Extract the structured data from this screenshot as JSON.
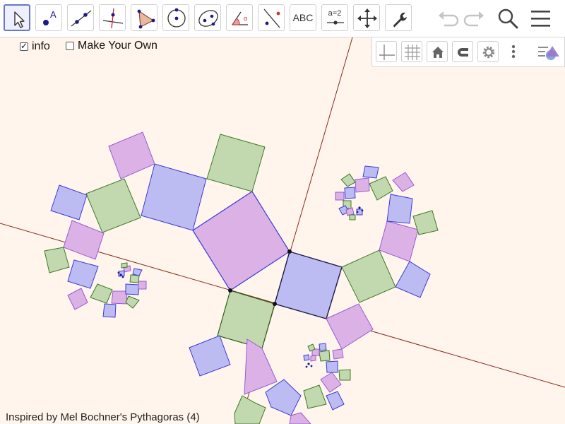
{
  "toolbar": {
    "tools": [
      {
        "name": "move-tool",
        "icon": "cursor-arrow-icon"
      },
      {
        "name": "point-tool",
        "icon": "point-icon"
      },
      {
        "name": "line-tool",
        "icon": "line-through-points-icon"
      },
      {
        "name": "perpendicular-line-tool",
        "icon": "perpendicular-icon"
      },
      {
        "name": "polygon-tool",
        "icon": "polygon-icon"
      },
      {
        "name": "circle-tool",
        "icon": "circle-center-icon"
      },
      {
        "name": "ellipse-tool",
        "icon": "ellipse-icon"
      },
      {
        "name": "angle-tool",
        "icon": "angle-icon"
      },
      {
        "name": "reflect-tool",
        "icon": "reflect-line-icon"
      },
      {
        "name": "text-tool",
        "label": "ABC"
      },
      {
        "name": "slider-tool",
        "label": "a=2"
      },
      {
        "name": "move-graphics-tool",
        "icon": "move-arrows-icon"
      },
      {
        "name": "tools-menu",
        "icon": "wrench-icon"
      }
    ],
    "controls": [
      {
        "name": "undo-button",
        "icon": "undo-icon",
        "enabled": false
      },
      {
        "name": "redo-button",
        "icon": "redo-icon",
        "enabled": false
      },
      {
        "name": "search-button",
        "icon": "search-icon"
      },
      {
        "name": "main-menu-button",
        "icon": "hamburger-menu-icon"
      }
    ]
  },
  "checkboxes": {
    "info": {
      "label": "info",
      "checked": true
    },
    "make_your_own": {
      "label": "Make Your Own",
      "checked": false
    }
  },
  "style_bar": {
    "buttons": [
      "axes-icon",
      "grid-icon",
      "home-icon",
      "magnet-snap-icon",
      "gear-icon",
      "more-vert-icon",
      "graphics-style-icon"
    ]
  },
  "caption": "Inspired by Mel Bochner's Pythagoras (4)",
  "colors": {
    "background": "#fff5ec",
    "blue_square": "#bcbcf2",
    "blue_stroke": "#3a3ad8",
    "purple_square": "#dcb2e6",
    "purple_stroke": "#9a5ad0",
    "green_square": "#c2d8ae",
    "green_stroke": "#3d7a28",
    "axis_line": "#8b2a1a"
  }
}
